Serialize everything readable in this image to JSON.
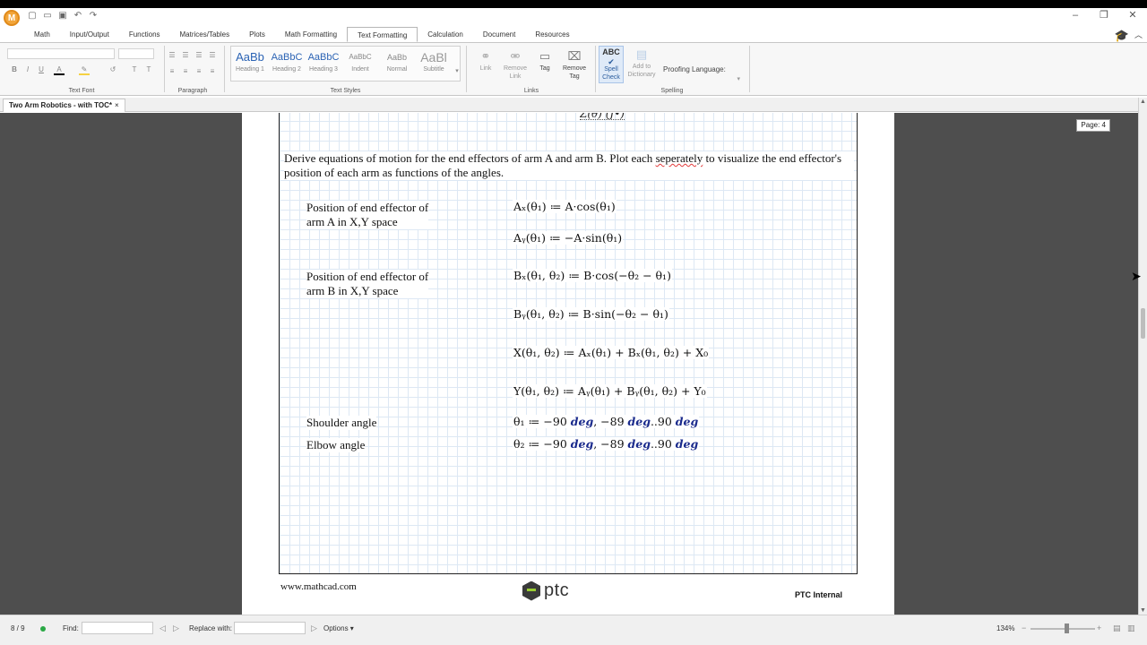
{
  "titlebar": {
    "app_logo": "M",
    "qat": [
      "new-icon",
      "open-icon",
      "save-icon",
      "undo-icon",
      "redo-icon"
    ],
    "controls": [
      "minimize-icon",
      "restore-icon",
      "close-icon"
    ]
  },
  "ribbon_tabs": [
    "Math",
    "Input/Output",
    "Functions",
    "Matrices/Tables",
    "Plots",
    "Math Formatting",
    "Text Formatting",
    "Calculation",
    "Document",
    "Resources"
  ],
  "active_tab": "Text Formatting",
  "ribbon": {
    "groups": {
      "text_font": "Text Font",
      "paragraph": "Paragraph",
      "text_styles": "Text Styles",
      "links": "Links",
      "spelling": "Spelling"
    },
    "styles": [
      {
        "sample": "AaBb",
        "name": "Heading 1"
      },
      {
        "sample": "AaBbC",
        "name": "Heading 2"
      },
      {
        "sample": "AaBbC",
        "name": "Heading 3"
      },
      {
        "sample": "AaBbC",
        "name": "Indent"
      },
      {
        "sample": "AaBb",
        "name": "Normal"
      },
      {
        "sample": "AaBl",
        "name": "Subtitle"
      }
    ],
    "links": [
      {
        "name": "Link",
        "line2": ""
      },
      {
        "name": "Remove",
        "line2": "Link"
      },
      {
        "name": "Tag",
        "line2": ""
      },
      {
        "name": "Remove",
        "line2": "Tag"
      }
    ],
    "spell_check": {
      "icon": "ABC",
      "line1": "Spell",
      "line2": "Check"
    },
    "add_dictionary": {
      "line1": "Add to",
      "line2": "Dictionary"
    },
    "proofing_label": "Proofing Language:"
  },
  "document_tab": {
    "title": "Two Arm Robotics - with TOC*",
    "close": "×"
  },
  "page_badge": "Page: 4",
  "worksheet": {
    "cutoff_equation": "Z(θ) (J•)",
    "paragraph_before": "Derive equations of motion for the end effectors of arm A and arm B. Plot each ",
    "paragraph_spell": "seperately",
    "paragraph_after": " to visualize the end effector's position of each arm as functions of the angles.",
    "label_a": "Position of end effector of\narm A in X,Y space",
    "label_b": "Position of end effector of\narm B in X,Y space",
    "label_shoulder": "Shoulder angle",
    "label_elbow": "Elbow angle",
    "equations": {
      "ax": "Aₓ(θ₁) ≔ A·cos(θ₁)",
      "ay": "Aᵧ(θ₁) ≔ −A·sin(θ₁)",
      "bx": "Bₓ(θ₁, θ₂) ≔ B·cos(−θ₂ − θ₁)",
      "by": "Bᵧ(θ₁, θ₂) ≔ B·sin(−θ₂ − θ₁)",
      "x": "X(θ₁, θ₂) ≔ Aₓ(θ₁) + Bₓ(θ₁, θ₂) + X₀",
      "y": "Y(θ₁, θ₂) ≔ Aᵧ(θ₁) + Bᵧ(θ₁, θ₂) + Y₀",
      "theta1_prefix": "θ₁ ≔ −90 ",
      "theta2_prefix": "θ₂ ≔ −90 ",
      "range_mid": ", −89 ",
      "range_end": "..90 ",
      "unit": "deg"
    }
  },
  "footer": {
    "url": "www.mathcad.com",
    "logo_text": "ptc",
    "right": "PTC Internal"
  },
  "statusbar": {
    "page_count": "8 / 9",
    "find_label": "Find:",
    "replace_label": "Replace with:",
    "options_label": "Options",
    "zoom": "134%"
  }
}
